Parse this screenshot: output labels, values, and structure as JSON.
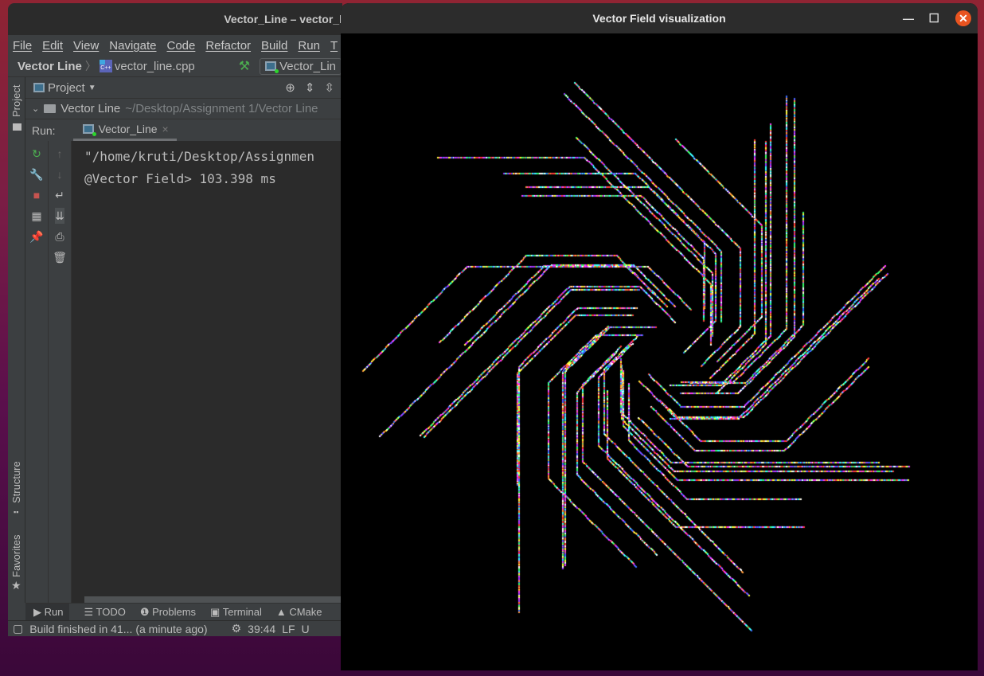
{
  "ide": {
    "title": "Vector_Line – vector_l",
    "menu": [
      "File",
      "Edit",
      "View",
      "Navigate",
      "Code",
      "Refactor",
      "Build",
      "Run",
      "T"
    ],
    "breadcrumb": {
      "project": "Vector Line",
      "file": "vector_line.cpp"
    },
    "run_config": "Vector_Lin",
    "project_panel": {
      "label": "Project",
      "root": "Vector Line",
      "root_path": "~/Desktop/Assignment 1/Vector Line"
    },
    "left_strip": {
      "project": "Project",
      "structure": "Structure",
      "favorites": "Favorites"
    },
    "run": {
      "label": "Run:",
      "tab": "Vector_Line"
    },
    "console_lines": [
      "\"/home/kruti/Desktop/Assignmen",
      "@Vector Field> 103.398 ms"
    ],
    "bottom_tabs": [
      "Run",
      "TODO",
      "Problems",
      "Terminal",
      "CMake"
    ],
    "status": {
      "message": "Build finished in 41... (a minute ago)",
      "position": "39:44",
      "line_ending": "LF",
      "encoding": "U"
    }
  },
  "viz": {
    "title": "Vector Field visualization",
    "close_color": "#e95420"
  }
}
